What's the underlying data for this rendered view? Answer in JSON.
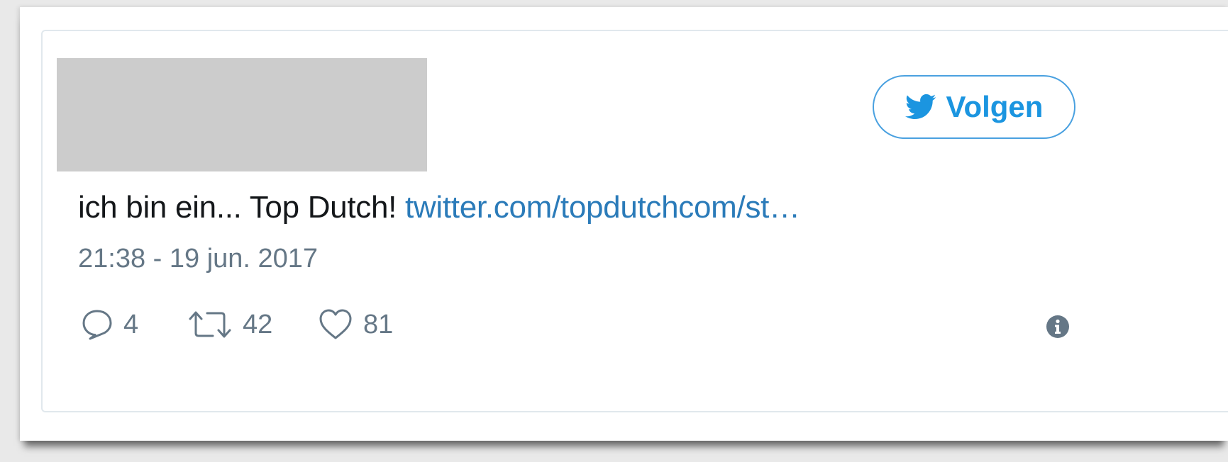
{
  "tweet": {
    "follow_label": "Volgen",
    "text": "ich bin ein... Top Dutch! ",
    "link_text": "twitter.com/topdutchcom/st…",
    "timestamp": "21:38 - 19 jun. 2017",
    "replies": "4",
    "retweets": "42",
    "likes": "81"
  },
  "colors": {
    "accent": "#1b95e0",
    "link": "#2b7bb9",
    "muted": "#657786",
    "text": "#14171a",
    "redacted": "#cccccc"
  },
  "icons": {
    "follow": "twitter-bird-icon",
    "reply": "reply-icon",
    "retweet": "retweet-icon",
    "like": "heart-icon",
    "info": "info-icon"
  }
}
